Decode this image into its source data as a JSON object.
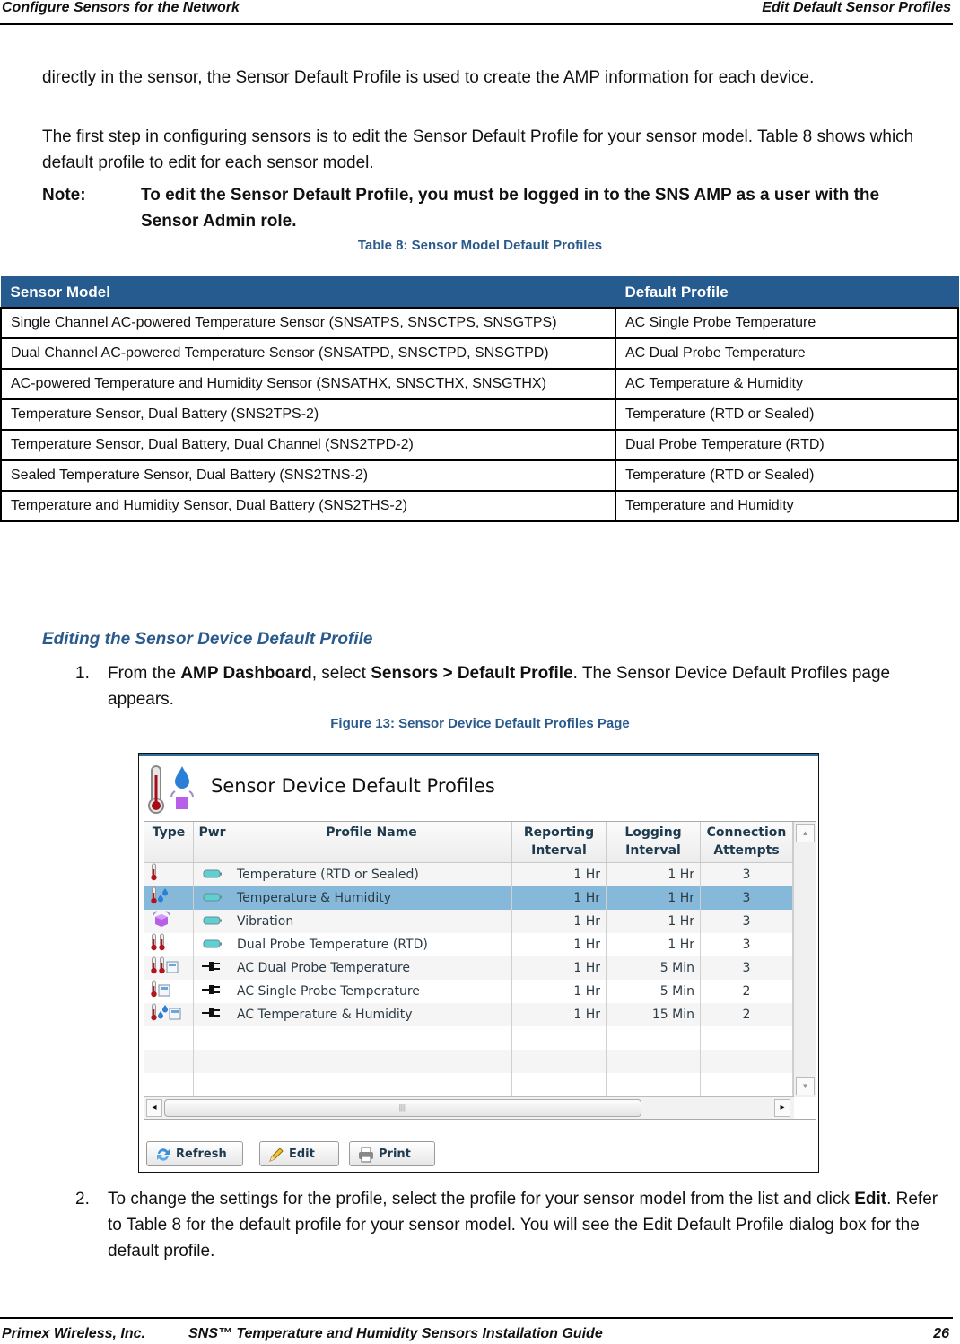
{
  "header": {
    "left": "Configure Sensors for the Network",
    "right": "Edit Default Sensor Profiles"
  },
  "intro": {
    "p1": "directly in the sensor, the Sensor Default Profile is used to create the AMP information for each device.",
    "p2": "The first step in configuring sensors is to edit the Sensor Default Profile for your sensor model. Table 8 shows which default profile to edit for each sensor model.",
    "note_label": "Note:",
    "note_text": "To edit the Sensor Default Profile, you must be logged in to the SNS AMP as a user with the Sensor Admin role."
  },
  "table8": {
    "caption": "Table 8: Sensor Model Default Profiles",
    "headers": [
      "Sensor Model",
      "Default Profile"
    ],
    "rows": [
      [
        "Single Channel AC-powered Temperature Sensor (SNSATPS, SNSCTPS, SNSGTPS)",
        "AC Single Probe Temperature"
      ],
      [
        "Dual Channel AC-powered Temperature Sensor (SNSATPD, SNSCTPD, SNSGTPD)",
        "AC Dual Probe Temperature"
      ],
      [
        "AC-powered Temperature and Humidity Sensor (SNSATHX, SNSCTHX, SNSGTHX)",
        "AC Temperature & Humidity"
      ],
      [
        "Temperature Sensor, Dual Battery (SNS2TPS-2)",
        "Temperature (RTD or Sealed)"
      ],
      [
        "Temperature Sensor, Dual Battery, Dual Channel (SNS2TPD-2)",
        "Dual Probe Temperature (RTD)"
      ],
      [
        "Sealed Temperature Sensor, Dual Battery (SNS2TNS-2)",
        "Temperature (RTD or Sealed)"
      ],
      [
        "Temperature and Humidity Sensor, Dual Battery (SNS2THS-2)",
        "Temperature and Humidity"
      ]
    ],
    "header_color": "#265b8f"
  },
  "section": {
    "heading": "Editing the Sensor Device Default Profile",
    "step1": {
      "num": "1.",
      "pre": "From the ",
      "b1": "AMP Dashboard",
      "mid": ", select ",
      "b2": "Sensors > Default Profile",
      "post": ". The Sensor Device Default Profiles page appears."
    },
    "figure_caption": "Figure 13: Sensor Device Default Profiles Page",
    "step2": {
      "num": "2.",
      "pre": "To change the settings for the profile, select the profile for your sensor model from the list and click ",
      "b1": "Edit",
      "post": ". Refer to Table 8 for the default profile for your sensor model. You will see the Edit Default Profile dialog box for the default profile."
    }
  },
  "screenshot": {
    "title": "Sensor Device Default Profiles",
    "columns": {
      "type": "Type",
      "pwr": "Pwr",
      "name": "Profile Name",
      "reporting": [
        "Reporting",
        "Interval"
      ],
      "logging": [
        "Logging",
        "Interval"
      ],
      "connection": [
        "Connection",
        "Attempts"
      ]
    },
    "rows": [
      {
        "type_icons": [
          "thermometer-icon"
        ],
        "power": "battery",
        "name": "Temperature (RTD or Sealed)",
        "reporting": "1 Hr",
        "logging": "1 Hr",
        "attempts": "3",
        "selected": false
      },
      {
        "type_icons": [
          "thermometer-icon",
          "humidity-drops-icon"
        ],
        "power": "battery",
        "name": "Temperature & Humidity",
        "reporting": "1 Hr",
        "logging": "1 Hr",
        "attempts": "3",
        "selected": true
      },
      {
        "type_icons": [
          "vibration-cube-icon"
        ],
        "power": "battery",
        "name": "Vibration",
        "reporting": "1 Hr",
        "logging": "1 Hr",
        "attempts": "3",
        "selected": false
      },
      {
        "type_icons": [
          "thermometer-icon",
          "thermometer-icon"
        ],
        "power": "battery",
        "name": "Dual Probe Temperature (RTD)",
        "reporting": "1 Hr",
        "logging": "1 Hr",
        "attempts": "3",
        "selected": false
      },
      {
        "type_icons": [
          "thermometer-icon",
          "thermometer-icon",
          "display-icon"
        ],
        "power": "ac-plug",
        "name": "AC Dual Probe Temperature",
        "reporting": "1 Hr",
        "logging": "5 Min",
        "attempts": "3",
        "selected": false
      },
      {
        "type_icons": [
          "thermometer-icon",
          "display-icon"
        ],
        "power": "ac-plug",
        "name": "AC Single Probe Temperature",
        "reporting": "1 Hr",
        "logging": "5 Min",
        "attempts": "2",
        "selected": false
      },
      {
        "type_icons": [
          "thermometer-icon",
          "humidity-drops-icon",
          "display-icon"
        ],
        "power": "ac-plug",
        "name": "AC Temperature & Humidity",
        "reporting": "1 Hr",
        "logging": "15 Min",
        "attempts": "2",
        "selected": false
      }
    ],
    "buttons": {
      "refresh": "Refresh",
      "edit": "Edit",
      "print": "Print"
    },
    "selected_row_color": "#86b8d9"
  },
  "footer": {
    "company": "Primex Wireless, Inc.",
    "doc": "SNS™ Temperature and Humidity Sensors Installation Guide",
    "page": "26"
  }
}
